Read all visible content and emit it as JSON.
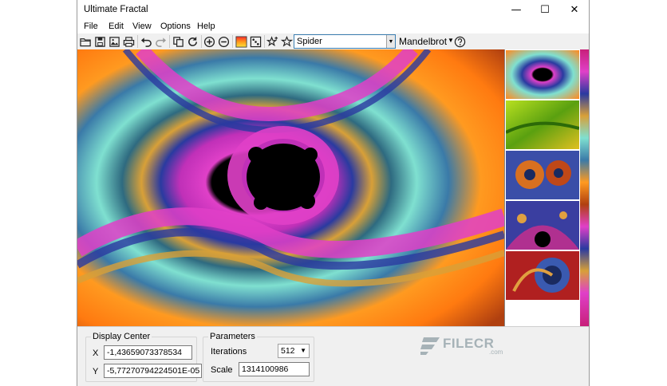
{
  "window": {
    "title": "Ultimate Fractal",
    "minimize_glyph": "—",
    "maximize_glyph": "☐",
    "close_glyph": "✕"
  },
  "menu": [
    "File",
    "Edit",
    "View",
    "Options",
    "Help"
  ],
  "toolbar": {
    "icons": [
      "open-folder-icon",
      "save-icon",
      "export-image-icon",
      "print-icon",
      "undo-icon",
      "redo-icon",
      "copy-icon",
      "refresh-icon",
      "zoom-in-icon",
      "zoom-out-icon",
      "palette-icon",
      "randomize-icon",
      "add-favorite-icon",
      "favorite-icon"
    ],
    "preset_value": "Spider",
    "formula_label": "Mandelbrot",
    "help_icon": "help-icon"
  },
  "display_center": {
    "group_label": "Display Center",
    "x_label": "X",
    "x_value": "-1,43659073378534",
    "y_label": "Y",
    "y_value": "-5,77270794224501E-05"
  },
  "parameters": {
    "group_label": "Parameters",
    "iterations_label": "Iterations",
    "iterations_value": "512",
    "scale_label": "Scale",
    "scale_value": "1314100986"
  },
  "watermark": {
    "text": "FILECR",
    "sub": ".com"
  },
  "colors": {
    "accent_border": "#3c7fb1",
    "panel_bg": "#f0f0f0"
  }
}
